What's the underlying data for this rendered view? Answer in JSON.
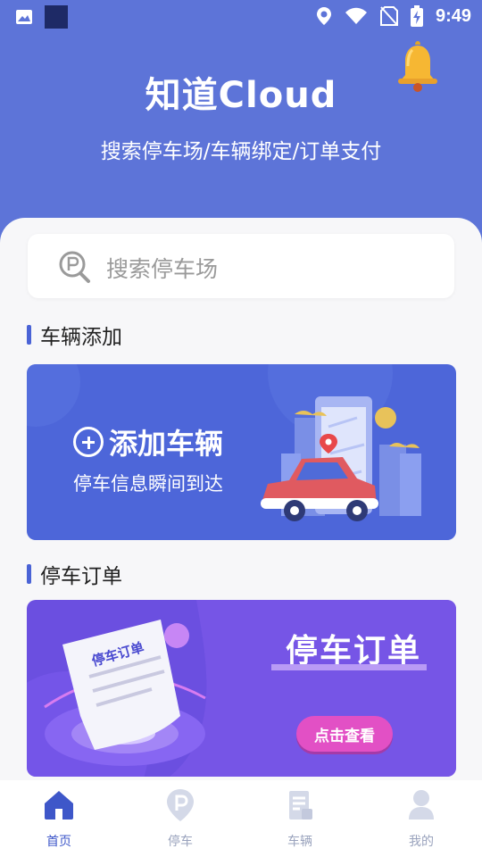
{
  "status_bar": {
    "time": "9:49",
    "icons": [
      "gallery-icon",
      "square-app-icon",
      "location-icon",
      "wifi-icon",
      "no-sim-icon",
      "battery-charging-icon"
    ]
  },
  "header": {
    "title": "知道Cloud",
    "subtitle": "搜索停车场/车辆绑定/订单支付",
    "notification_icon": "bell-icon",
    "bg_color": "#5d74d8"
  },
  "search": {
    "placeholder": "搜索停车场",
    "icon": "parking-search-icon"
  },
  "sections": {
    "vehicle": {
      "title": "车辆添加",
      "card_title": "添加车辆",
      "card_subtitle": "停车信息瞬间到达"
    },
    "order": {
      "title": "停车订单",
      "card_title": "停车订单",
      "card_button": "点击查看",
      "paper_label": "停车订单"
    }
  },
  "bottom_nav": {
    "items": [
      {
        "label": "首页",
        "icon": "home-icon",
        "active": true
      },
      {
        "label": "停车",
        "icon": "parking-pin-icon",
        "active": false
      },
      {
        "label": "车辆",
        "icon": "vehicle-doc-icon",
        "active": false
      },
      {
        "label": "我的",
        "icon": "user-icon",
        "active": false
      }
    ]
  },
  "colors": {
    "accent": "#4a63d6",
    "vehicle_card": "#4d66d9",
    "order_card": "#6b4fe0",
    "nav_active": "#3e57c9",
    "nav_inactive": "#9aa3bd"
  }
}
